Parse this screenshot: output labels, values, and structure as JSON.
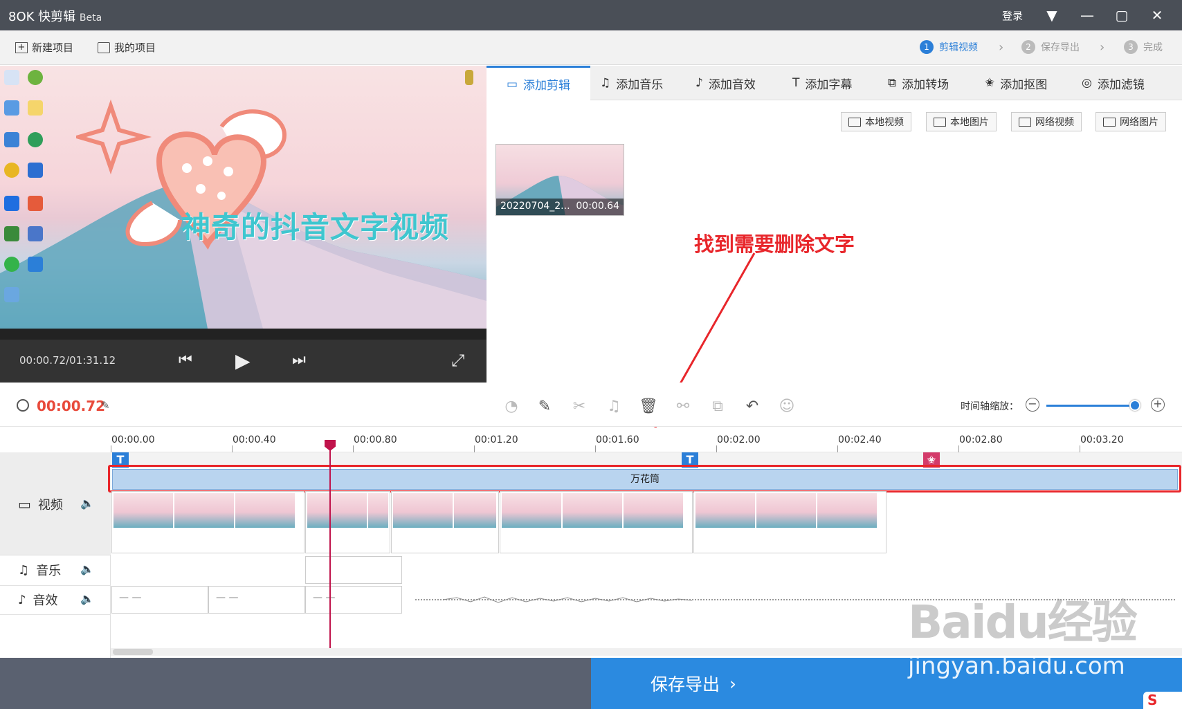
{
  "app": {
    "logo": "8OK 快剪辑",
    "badge": "Beta",
    "login": "登录"
  },
  "toolbar": {
    "new_project": "新建项目",
    "my_projects": "我的项目"
  },
  "steps": [
    {
      "num": "1",
      "label": "剪辑视频",
      "active": true
    },
    {
      "num": "2",
      "label": "保存导出",
      "active": false
    },
    {
      "num": "3",
      "label": "完成",
      "active": false
    }
  ],
  "preview": {
    "overlay_text": "神奇的抖音文字视频",
    "timecode": "00:00.72/01:31.12"
  },
  "tabs": [
    {
      "label": "添加剪辑",
      "icon": "video-camera-icon",
      "active": true
    },
    {
      "label": "添加音乐",
      "icon": "music-note-icon"
    },
    {
      "label": "添加音效",
      "icon": "sound-effect-icon"
    },
    {
      "label": "添加字幕",
      "icon": "text-t-icon"
    },
    {
      "label": "添加转场",
      "icon": "transition-icon"
    },
    {
      "label": "添加抠图",
      "icon": "cutout-star-icon"
    },
    {
      "label": "添加滤镜",
      "icon": "filter-icon"
    }
  ],
  "sources": [
    {
      "label": "本地视频"
    },
    {
      "label": "本地图片"
    },
    {
      "label": "网络视频"
    },
    {
      "label": "网络图片"
    }
  ],
  "media": {
    "name": "20220704_2...",
    "duration": "00:00.64"
  },
  "annotation": "找到需要删除文字",
  "timeline": {
    "current_time": "00:00.72",
    "zoom_label": "时间轴缩放：",
    "zoom_level": 0.9,
    "ruler": [
      "00:00.00",
      "00:00.40",
      "00:00.80",
      "00:01.20",
      "00:01.60",
      "00:02.00",
      "00:02.40",
      "00:02.80",
      "00:03.20"
    ],
    "tracks": {
      "video": "视频",
      "music": "音乐",
      "sfx": "音效"
    },
    "effect_clip": "万花筒",
    "sfx_clips": [
      "— —",
      "— —",
      "— —"
    ]
  },
  "export_button": "保存导出",
  "watermark": {
    "line1": "Baidu经验",
    "line2": "jingyan.baidu.com"
  },
  "colors": {
    "accent": "#2b7fd8",
    "annotation": "#e8262b",
    "playhead": "#c0134b",
    "time": "#e84a3b"
  }
}
